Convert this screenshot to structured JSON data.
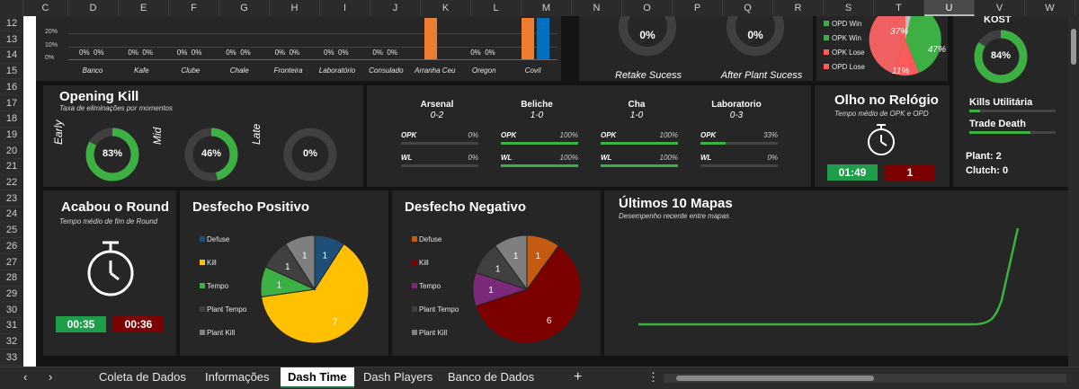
{
  "columns": [
    "C",
    "D",
    "E",
    "F",
    "G",
    "H",
    "I",
    "J",
    "K",
    "L",
    "M",
    "N",
    "O",
    "P",
    "Q",
    "R",
    "S",
    "T",
    "U",
    "V",
    "W"
  ],
  "selected_column": "U",
  "rows": [
    "12",
    "13",
    "14",
    "15",
    "16",
    "17",
    "18",
    "19",
    "20",
    "21",
    "22",
    "23",
    "24",
    "25",
    "26",
    "27",
    "28",
    "29",
    "30",
    "31",
    "32",
    "33"
  ],
  "top_chart": {
    "y_ticks": [
      "20%",
      "10%",
      "0%"
    ],
    "maps": [
      {
        "name": "Banco",
        "a": "0%",
        "b": "0%"
      },
      {
        "name": "Kafe",
        "a": "0%",
        "b": "0%"
      },
      {
        "name": "Clube",
        "a": "0%",
        "b": "0%"
      },
      {
        "name": "Chale",
        "a": "0%",
        "b": "0%"
      },
      {
        "name": "Fronteira",
        "a": "0%",
        "b": "0%"
      },
      {
        "name": "Laboratório",
        "a": "0%",
        "b": "0%"
      },
      {
        "name": "Consulado",
        "a": "0%",
        "b": "0%"
      },
      {
        "name": "Arranha Ceu",
        "a": "",
        "b": ""
      },
      {
        "name": "Oregon",
        "a": "0%",
        "b": "0%"
      },
      {
        "name": "Covil",
        "a": "",
        "b": ""
      }
    ]
  },
  "retake": {
    "value": "0%",
    "label": "Retake Sucess",
    "value_num": 0
  },
  "after_plant": {
    "value": "0%",
    "label": "After Plant Sucess",
    "value_num": 0
  },
  "opd_legend": [
    "OPD Win",
    "OPK Win",
    "OPK Lose",
    "OPD Lose"
  ],
  "opd_pie": {
    "labels": [
      "37%",
      "47%",
      "11%"
    ]
  },
  "kost": {
    "title": "KOST",
    "value": "84%",
    "value_num": 84
  },
  "kills_utilitaria": "Kills Utilitária",
  "trade_death": "Trade Death",
  "plant": "Plant: 2",
  "clutch": "Clutch: 0",
  "opening_kill": {
    "title": "Opening Kill",
    "subtitle": "Taxa de eliminações por momentos",
    "items": [
      {
        "label": "Early",
        "value": "83%",
        "value_num": 83
      },
      {
        "label": "Mid",
        "value": "46%",
        "value_num": 46
      },
      {
        "label": "Late",
        "value": "0%",
        "value_num": 0
      }
    ]
  },
  "maps_stats": [
    {
      "name": "Arsenal",
      "score": "0-2",
      "opk": "0%",
      "opk_num": 0,
      "wl": "0%",
      "wl_num": 0
    },
    {
      "name": "Beliche",
      "score": "1-0",
      "opk": "100%",
      "opk_num": 100,
      "wl": "100%",
      "wl_num": 100
    },
    {
      "name": "Cha",
      "score": "1-0",
      "opk": "100%",
      "opk_num": 100,
      "wl": "100%",
      "wl_num": 100
    },
    {
      "name": "Laboratorio",
      "score": "0-3",
      "opk": "33%",
      "opk_num": 33,
      "wl": "0%",
      "wl_num": 0
    }
  ],
  "opk_label": "OPK",
  "wl_label": "WL",
  "olho": {
    "title": "Olho no Relógio",
    "subtitle": "Tempo médio de OPK e OPD",
    "time_a": "01:49",
    "time_b": "1"
  },
  "acabou": {
    "title": "Acabou o Round",
    "subtitle": "Tempo médio de fim de Round",
    "time_a": "00:35",
    "time_b": "00:36"
  },
  "desfecho_pos": {
    "title": "Desfecho Positivo",
    "legend": [
      "Defuse",
      "Kill",
      "Tempo",
      "Plant Tempo",
      "Plant Kill"
    ],
    "values": [
      1,
      7,
      1,
      1,
      1
    ],
    "colors": [
      "#1f4e79",
      "#ffc000",
      "#3cb043",
      "#404040",
      "#7f7f7f"
    ]
  },
  "desfecho_neg": {
    "title": "Desfecho Negativo",
    "legend": [
      "Defuse",
      "Kill",
      "Tempo",
      "Plant Tempo",
      "Plant Kill"
    ],
    "values": [
      1,
      6,
      1,
      1,
      1
    ],
    "colors": [
      "#c55a11",
      "#7b0000",
      "#7a2a78",
      "#404040",
      "#7f7f7f"
    ]
  },
  "ultimos": {
    "title": "Últimos 10 Mapas",
    "subtitle": "Desempenho recente entre mapas"
  },
  "tabs": [
    "Coleta de Dados",
    "Informações",
    "Dash Time",
    "Dash Players",
    "Banco de Dados"
  ],
  "active_tab": "Dash Time",
  "add_tab": "+",
  "tab_menu": "⋮",
  "colors": {
    "green": "#3cb043",
    "red": "#7b0000",
    "orange": "#ed7d31",
    "blue": "#0070c0",
    "panel": "#262626"
  }
}
